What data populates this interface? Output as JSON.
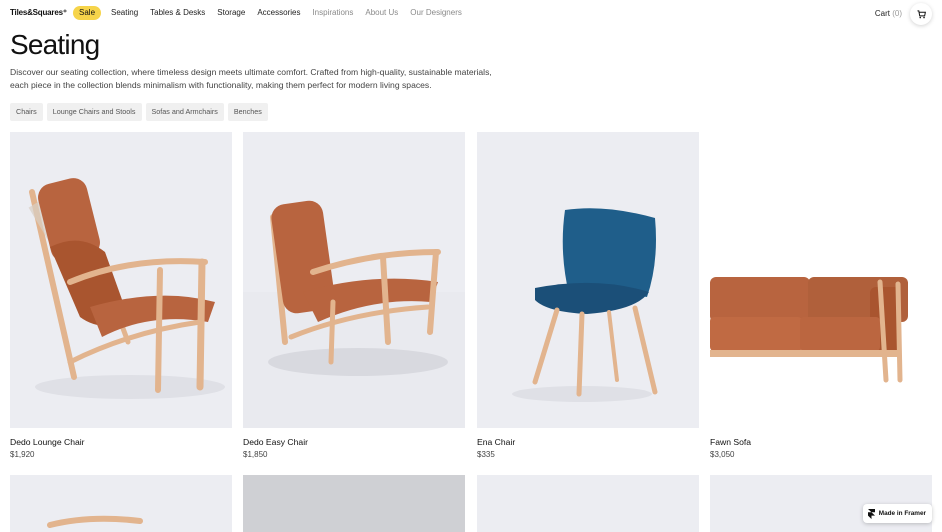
{
  "nav": {
    "logo": "Tiles&Squares⁺",
    "sale": "Sale",
    "links": [
      "Seating",
      "Tables & Desks",
      "Storage",
      "Accessories"
    ],
    "muted_links": [
      "Inspirations",
      "About Us",
      "Our Designers"
    ],
    "cart_label": "Cart",
    "cart_count": "(0)"
  },
  "page": {
    "title": "Seating",
    "description": "Discover our seating collection, where timeless design meets ultimate comfort. Crafted from high-quality, sustainable materials, each piece in the collection blends minimalism with functionality, making them perfect for modern living spaces."
  },
  "filters": [
    "Chairs",
    "Lounge Chairs and Stools",
    "Sofas and Armchairs",
    "Benches"
  ],
  "products": [
    {
      "name": "Dedo Lounge Chair",
      "price": "$1,920"
    },
    {
      "name": "Dedo Easy Chair",
      "price": "$1,850"
    },
    {
      "name": "Ena Chair",
      "price": "$335"
    },
    {
      "name": "Fawn Sofa",
      "price": "$3,050"
    }
  ],
  "badge": {
    "label": "Made in Framer"
  },
  "colors": {
    "accent_sale": "#f6d44a",
    "card_bg": "#ecedf2",
    "leather": "#b8643f",
    "wood": "#e2b48e",
    "blue_fabric": "#1f5e8a"
  }
}
